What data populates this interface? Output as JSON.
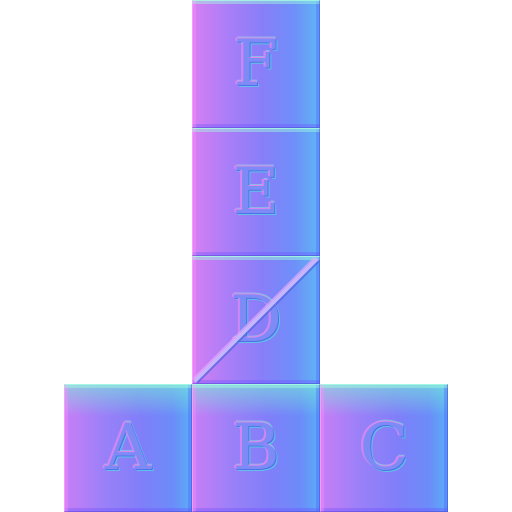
{
  "tiles": {
    "F": {
      "label": "F"
    },
    "E": {
      "label": "E"
    },
    "D": {
      "label": "D"
    },
    "A": {
      "label": "A"
    },
    "B": {
      "label": "B"
    },
    "C": {
      "label": "C"
    }
  }
}
